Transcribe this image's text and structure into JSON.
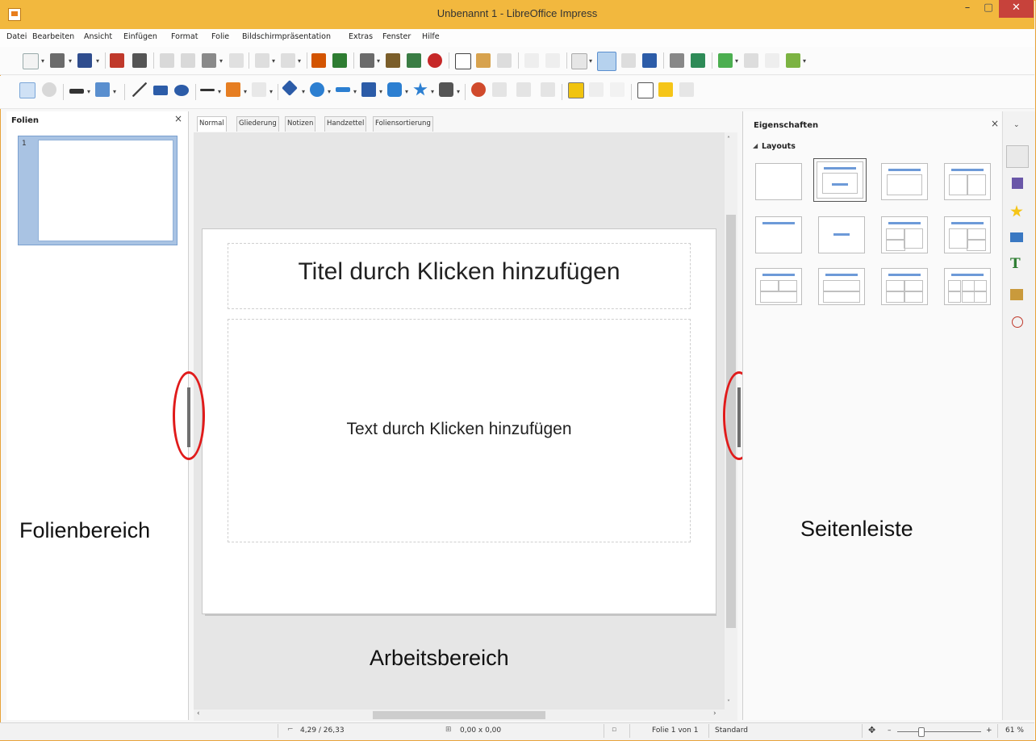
{
  "window": {
    "title": "Unbenannt 1 - LibreOffice Impress",
    "min_glyph": "–",
    "max_glyph": "▢",
    "close_glyph": "✕"
  },
  "menu": [
    "Datei",
    "Bearbeiten",
    "Ansicht",
    "Einfügen",
    "Format",
    "Folie",
    "Bildschirmpräsentation",
    "Extras",
    "Fenster",
    "Hilfe"
  ],
  "slides_pane": {
    "title": "Folien",
    "close_glyph": "×",
    "slide_number": "1"
  },
  "view_tabs": [
    "Normal",
    "Gliederung",
    "Notizen",
    "Handzettel",
    "Foliensortierung"
  ],
  "slide": {
    "title_placeholder": "Titel durch Klicken hinzufügen",
    "content_placeholder": "Text durch Klicken hinzufügen"
  },
  "sidebar": {
    "title": "Eigenschaften",
    "close_glyph": "×",
    "menu_glyph": "⌄",
    "section": "Layouts"
  },
  "annotations": {
    "slides_pane": "Folienbereich",
    "sidebar": "Seitenleiste",
    "workspace": "Arbeitsbereich"
  },
  "statusbar": {
    "position": "4,29 / 26,33",
    "size": "0,00 x 0,00",
    "slide_info": "Folie 1 von 1",
    "master": "Standard",
    "zoom": "61 %",
    "zoom_minus": "–",
    "zoom_plus": "+"
  },
  "colors": {
    "titlebar": "#f2b83e",
    "accent": "#6d9ad8",
    "annotation_oval": "#e01b1b",
    "close_button": "#c7423b"
  }
}
